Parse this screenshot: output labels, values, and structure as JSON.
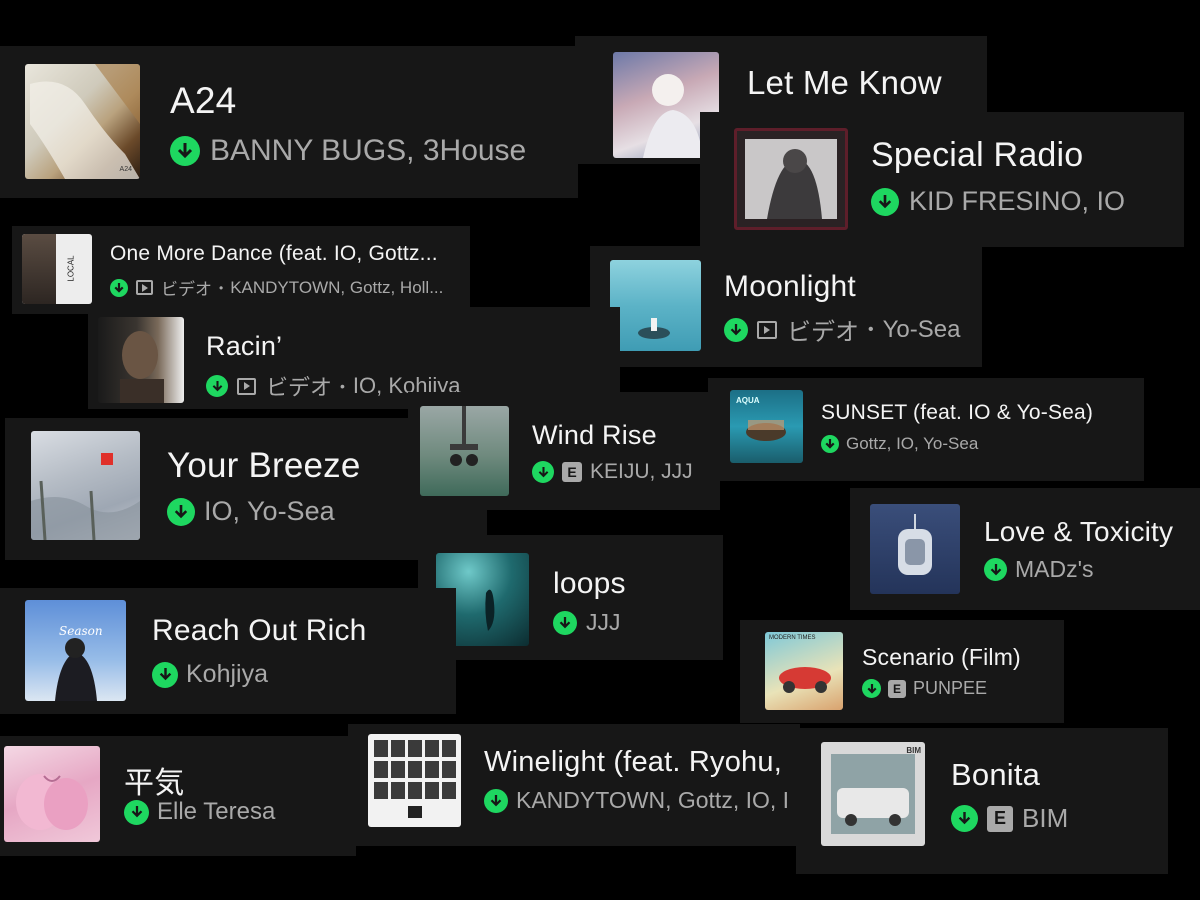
{
  "colors": {
    "background": "#000000",
    "card": "#171717",
    "download": "#1ed760",
    "subtext": "#a9a9a9"
  },
  "cards": {
    "a24": {
      "title": "A24",
      "artists": "BANNY BUGS, 3House",
      "art_text": "A24"
    },
    "let_me_know": {
      "title": "Let Me Know"
    },
    "special_radio": {
      "title": "Special Radio",
      "artists": "KID FRESINO, IO"
    },
    "one_more_dance": {
      "title": "One More Dance (feat. IO, Gottz...",
      "video_label": "ビデオ",
      "artists": "KANDYTOWN, Gottz, Holl...",
      "art_text": "LOCAL"
    },
    "moonlight": {
      "title": "Moonlight",
      "video_label": "ビデオ",
      "artists": "Yo-Sea"
    },
    "racin": {
      "title": "Racin’",
      "video_label": "ビデオ",
      "artists": "IO, Kohjiya"
    },
    "wind_rise": {
      "title": "Wind Rise",
      "explicit": "E",
      "artists": "KEIJU, JJJ"
    },
    "sunset": {
      "title": "SUNSET (feat. IO & Yo-Sea)",
      "artists": "Gottz, IO, Yo-Sea",
      "art_text": "AQUA"
    },
    "your_breeze": {
      "title": "Your Breeze",
      "artists": "IO, Yo-Sea"
    },
    "love_toxicity": {
      "title": "Love & Toxicity",
      "artists": "MADz's"
    },
    "loops": {
      "title": "loops",
      "artists": "JJJ"
    },
    "reach_out_rich": {
      "title": "Reach Out Rich",
      "artists": "Kohjiya",
      "art_text": "Season"
    },
    "scenario": {
      "title": "Scenario (Film)",
      "explicit": "E",
      "artists": "PUNPEE",
      "art_text": "MODERN TIMES"
    },
    "heiki": {
      "title": "平気",
      "artists": "Elle Teresa"
    },
    "winelight": {
      "title": "Winelight (feat. Ryohu,",
      "artists": "KANDYTOWN, Gottz, IO, I"
    },
    "bonita": {
      "title": "Bonita",
      "explicit": "E",
      "artists": "BIM",
      "art_text": "BIM"
    }
  },
  "separator": "•",
  "icons": {
    "download": "download-arrow-icon",
    "video": "video-play-icon",
    "explicit": "explicit-badge"
  }
}
